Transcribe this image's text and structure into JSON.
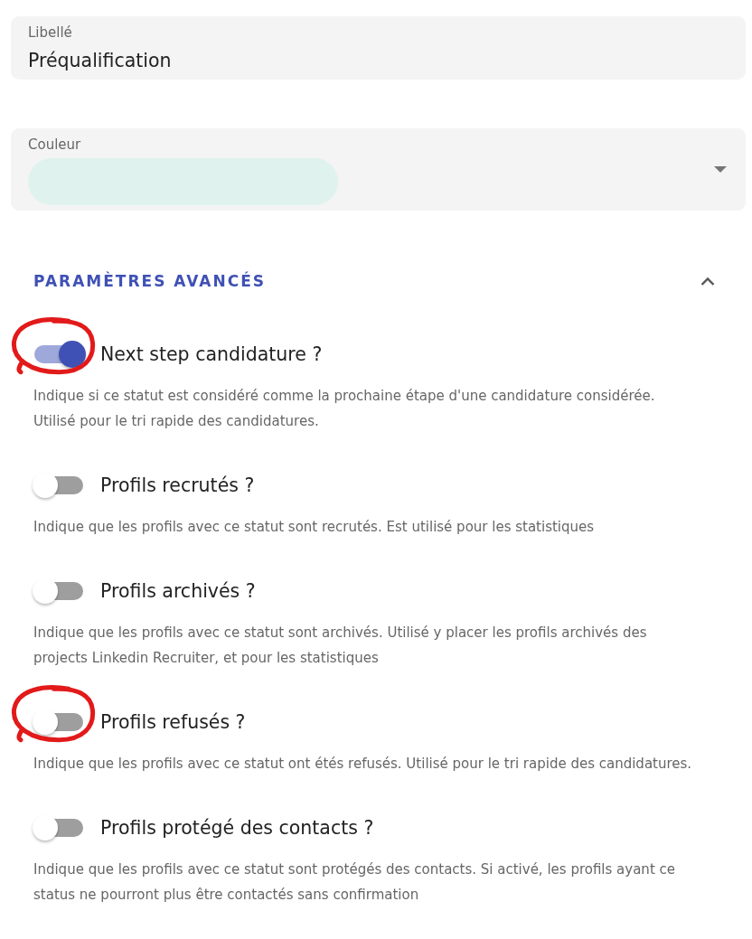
{
  "fields": [
    {
      "kind": "text",
      "label": "Libellé",
      "value": "Préqualification"
    },
    {
      "kind": "color",
      "label": "Couleur",
      "color": "#dff2ee"
    }
  ],
  "advanced": {
    "title": "PARAMÈTRES AVANCÉS",
    "expanded": true
  },
  "settings": [
    {
      "label": "Next step candidature ?",
      "on": true,
      "circled": true,
      "description": "Indique si ce statut est considéré comme la prochaine étape d'une candidature considérée.\nUtilisé pour le tri rapide des candidatures."
    },
    {
      "label": "Profils recrutés ?",
      "on": false,
      "circled": false,
      "description": "Indique que les profils avec ce statut sont recrutés. Est utilisé pour les statistiques"
    },
    {
      "label": "Profils archivés ?",
      "on": false,
      "circled": false,
      "description": "Indique que les profils avec ce statut sont archivés. Utilisé y placer les profils archivés des projects Linkedin Recruiter, et pour les statistiques"
    },
    {
      "label": "Profils refusés ?",
      "on": false,
      "circled": true,
      "description": "Indique que les profils avec ce statut ont étés refusés. Utilisé pour le tri rapide des candidatures."
    },
    {
      "label": "Profils protégé des contacts ?",
      "on": false,
      "circled": false,
      "description": "Indique que les profils avec ce statut sont protégés des contacts. Si activé, les profils ayant ce status ne pourront plus être contactés sans confirmation"
    }
  ]
}
